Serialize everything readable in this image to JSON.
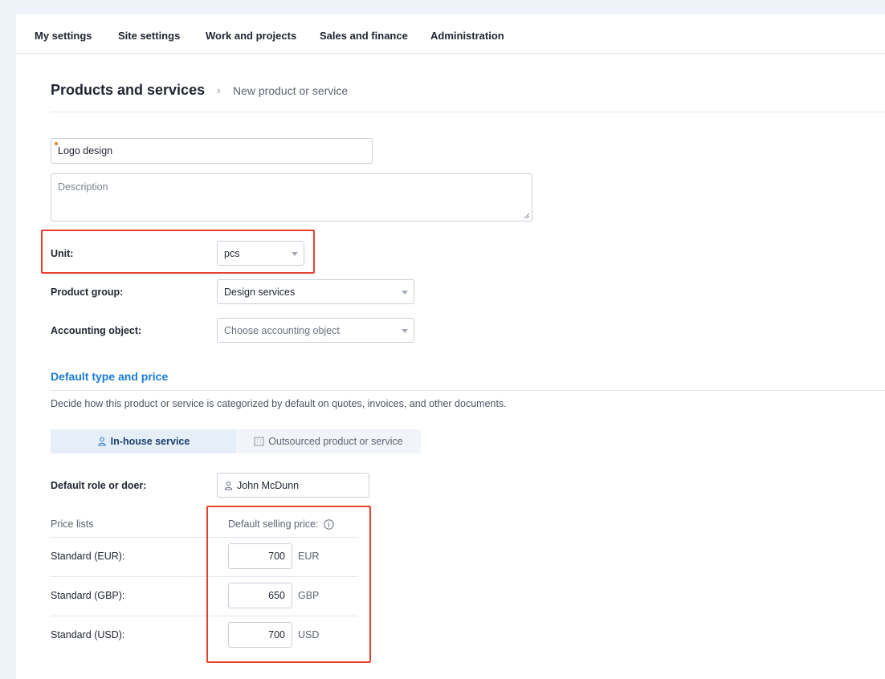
{
  "nav": {
    "items": [
      "My settings",
      "Site settings",
      "Work and projects",
      "Sales and finance",
      "Administration"
    ]
  },
  "breadcrumb": {
    "parent": "Products and services",
    "separator": "›",
    "current": "New product or service"
  },
  "form": {
    "name_value": "Logo design",
    "description_placeholder": "Description",
    "unit_label": "Unit:",
    "unit_value": "pcs",
    "product_group_label": "Product group:",
    "product_group_value": "Design services",
    "accounting_label": "Accounting object:",
    "accounting_placeholder": "Choose accounting object"
  },
  "default_section": {
    "title": "Default type and price",
    "description": "Decide how this product or service is categorized by default on quotes, invoices, and other documents.",
    "toggle": {
      "inhouse": "In-house service",
      "outsourced": "Outsourced product or service"
    },
    "doer_label": "Default role or doer:",
    "doer_value": "John McDunn"
  },
  "price_lists": {
    "header_left": "Price lists",
    "header_right": "Default selling price:",
    "rows": [
      {
        "name": "Standard (EUR):",
        "price": "700",
        "currency": "EUR"
      },
      {
        "name": "Standard (GBP):",
        "price": "650",
        "currency": "GBP"
      },
      {
        "name": "Standard (USD):",
        "price": "700",
        "currency": "USD"
      }
    ]
  },
  "colors": {
    "accent": "#1a7ad4",
    "highlight": "#e8402e",
    "required": "#f07a1a"
  }
}
